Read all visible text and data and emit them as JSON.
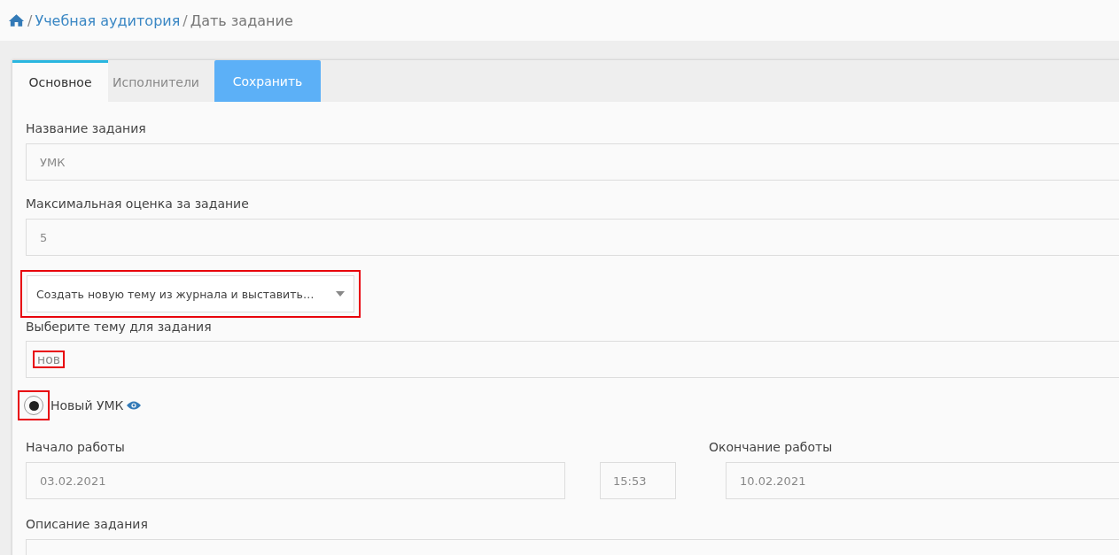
{
  "breadcrumb": {
    "separator_1": "/",
    "link": "Учебная аудитория",
    "separator_2": "/",
    "current": "Дать задание"
  },
  "tabs": [
    {
      "label": "Основное",
      "selected": true
    },
    {
      "label": "Исполнители",
      "selected": false
    }
  ],
  "save_button": "Сохранить",
  "task_name": {
    "label": "Название задания",
    "value": "УМК"
  },
  "max_grade": {
    "label": "Максимальная оценка за задание",
    "value": "5"
  },
  "topic_mode": {
    "value": "Создать новую тему из журнала и выставить…",
    "highlighted": true
  },
  "topic": {
    "label": "Выберите тему для задания",
    "value": "нов",
    "highlighted": true
  },
  "umk_option": {
    "label": "Новый УМК",
    "selected": true,
    "highlighted": true
  },
  "start": {
    "label": "Начало работы",
    "date": "03.02.2021",
    "time": "15:53"
  },
  "end": {
    "label": "Окончание работы",
    "date": "10.02.2021"
  },
  "description": {
    "label": "Описание задания"
  }
}
